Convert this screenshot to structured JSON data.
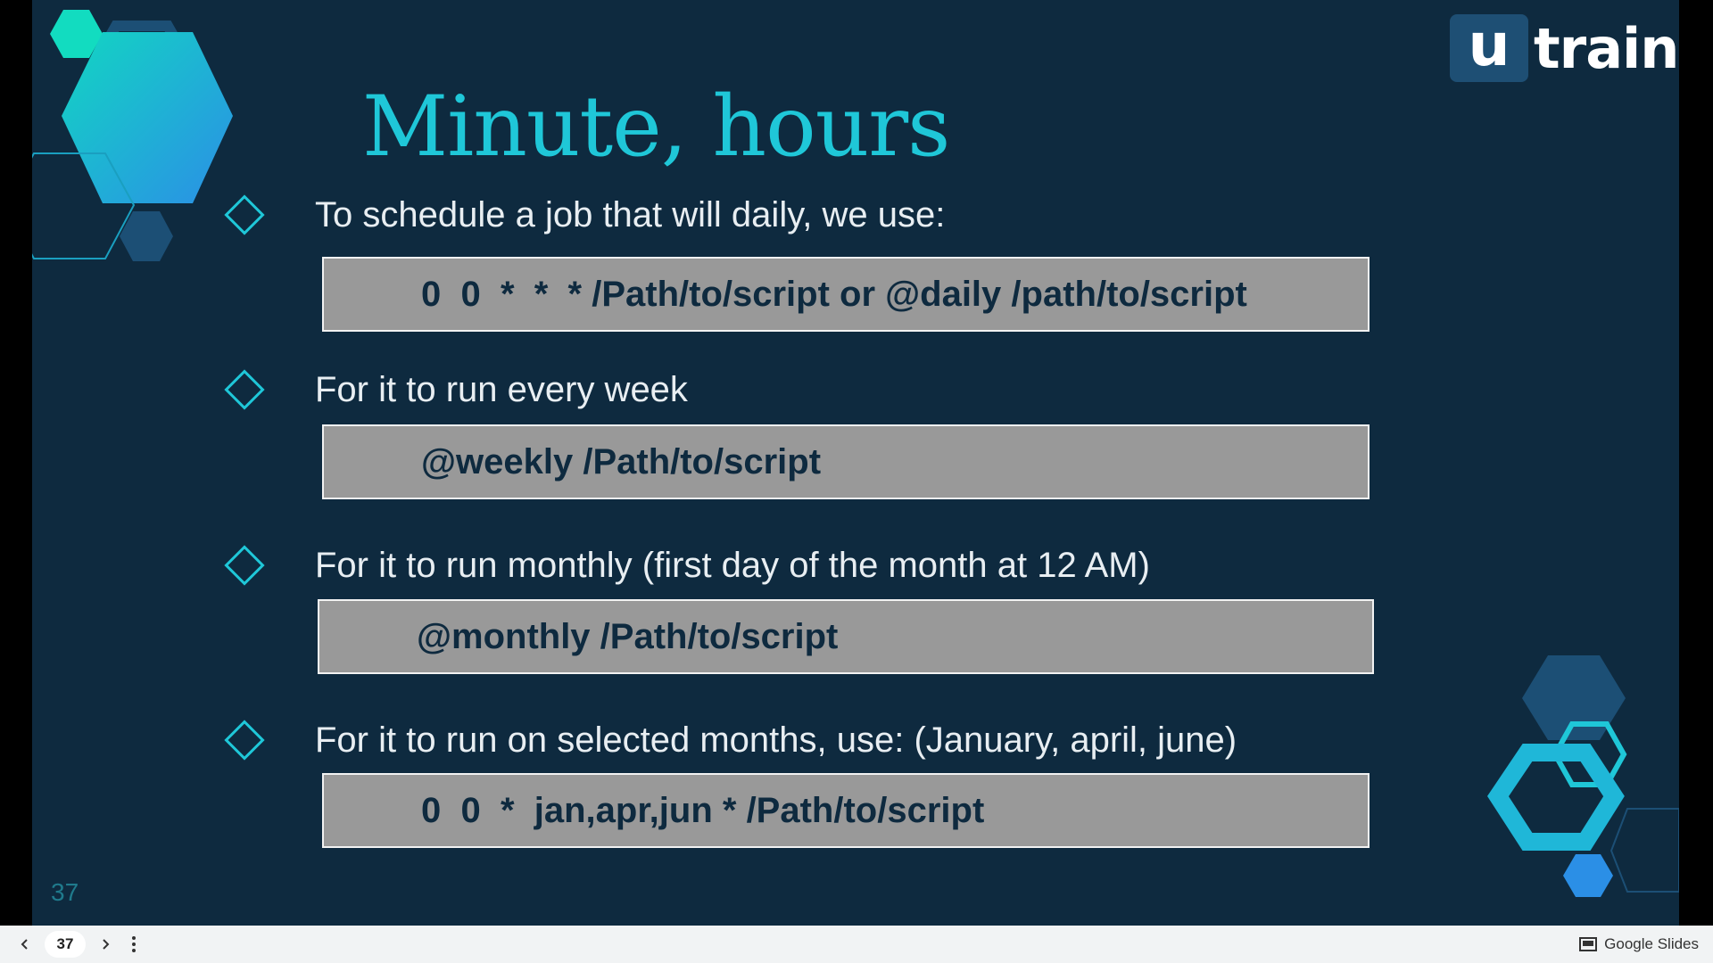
{
  "slide": {
    "logo": {
      "mark": "u",
      "text": "train"
    },
    "title": "Minute, hours",
    "slide_number": "37",
    "items": [
      {
        "text": "To schedule a job that will daily, we use:",
        "code": "0  0  *  *  * /Path/to/script or @daily /path/to/script"
      },
      {
        "text": "For it to run every week",
        "code": "@weekly /Path/to/script"
      },
      {
        "text": "For it to run monthly (first day of the month at 12 AM)",
        "code": "@monthly /Path/to/script"
      },
      {
        "text": "For it to run on selected months, use: (January, april, june)",
        "code": "0  0  *  jan,apr,jun * /Path/to/script"
      }
    ]
  },
  "toolbar": {
    "prev_icon": "chevron-left-icon",
    "page": "37",
    "next_icon": "chevron-right-icon",
    "more_icon": "more-vert-icon",
    "brand": "Google Slides"
  },
  "colors": {
    "background": "#0e2a3f",
    "accent": "#1fc7d8",
    "codebox": "#999999",
    "code_text": "#0e2a3f"
  }
}
